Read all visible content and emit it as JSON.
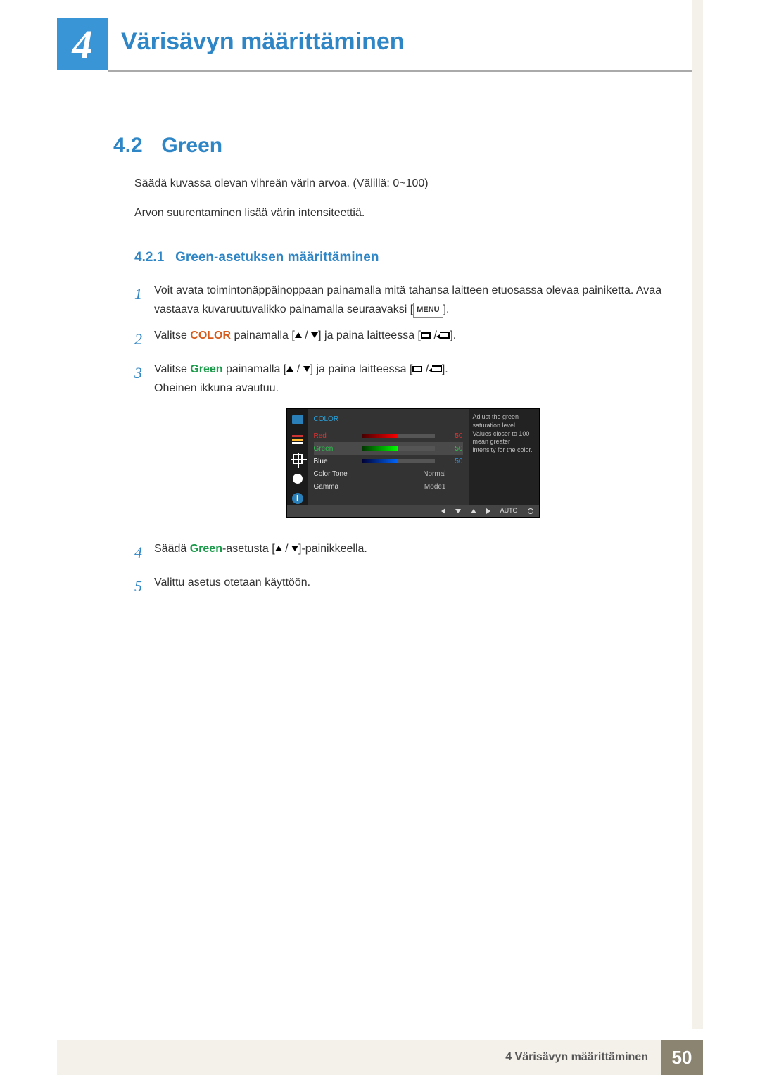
{
  "chapter": {
    "number": "4",
    "title": "Värisävyn määrittäminen"
  },
  "section": {
    "number": "4.2",
    "title": "Green"
  },
  "intro": {
    "p1": "Säädä kuvassa olevan vihreän värin arvoa. (Välillä: 0~100)",
    "p2": "Arvon suurentaminen lisää värin intensiteettiä."
  },
  "subsection": {
    "number": "4.2.1",
    "title": "Green-asetuksen määrittäminen"
  },
  "steps": {
    "s1a": "Voit avata toimintonäppäinoppaan painamalla mitä tahansa laitteen etuosassa olevaa painiketta. Avaa vastaava kuvaruutuvalikko painamalla seuraavaksi [",
    "s1b": "].",
    "menu_label": "MENU",
    "s2a": "Valitse ",
    "s2_kw": "COLOR",
    "s2b": " painamalla [",
    "s2c": "] ja paina laitteessa [",
    "s2d": "].",
    "s3a": "Valitse ",
    "s3_kw": "Green",
    "s3b": " painamalla [",
    "s3c": "] ja paina laitteessa [",
    "s3d": "].",
    "s3e": "Oheinen ikkuna avautuu.",
    "s4a": "Säädä ",
    "s4_kw": "Green",
    "s4b": "-asetusta [",
    "s4c": "]-painikkeella.",
    "s5": "Valittu asetus otetaan käyttöön."
  },
  "step_numbers": {
    "n1": "1",
    "n2": "2",
    "n3": "3",
    "n4": "4",
    "n5": "5"
  },
  "osd": {
    "title": "COLOR",
    "rows": {
      "red": {
        "label": "Red",
        "value": "50"
      },
      "green": {
        "label": "Green",
        "value": "50"
      },
      "blue": {
        "label": "Blue",
        "value": "50"
      },
      "tone": {
        "label": "Color Tone",
        "value": "Normal"
      },
      "gamma": {
        "label": "Gamma",
        "value": "Mode1"
      }
    },
    "help": "Adjust the green saturation level. Values closer to 100 mean greater intensity for the color.",
    "footer_auto": "AUTO",
    "info_glyph": "i"
  },
  "footer": {
    "text": "4 Värisävyn määrittäminen",
    "page": "50"
  }
}
